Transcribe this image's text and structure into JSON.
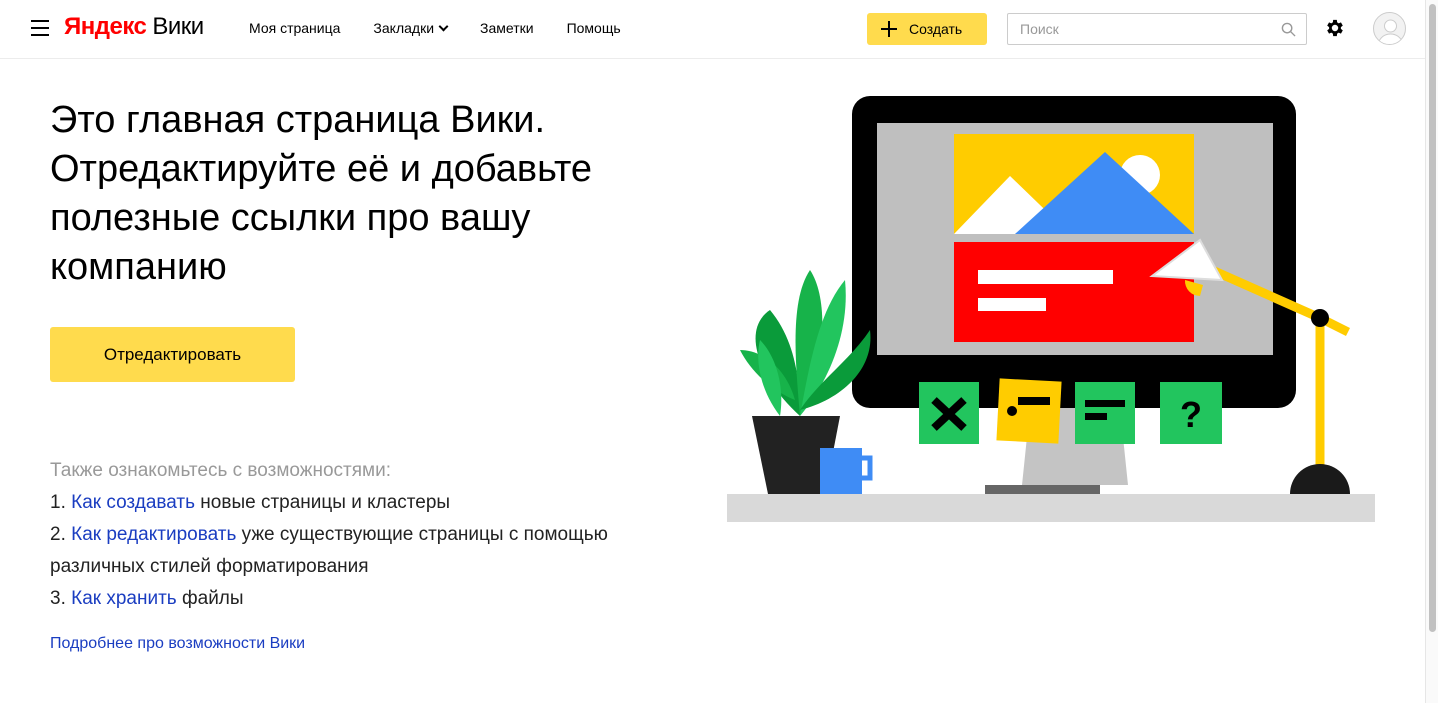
{
  "header": {
    "logo_brand": "Яндекс",
    "logo_product": "Вики",
    "nav": [
      {
        "label": "Моя страница"
      },
      {
        "label": "Закладки"
      },
      {
        "label": "Заметки"
      },
      {
        "label": "Помощь"
      }
    ],
    "create_label": "Создать",
    "search_placeholder": "Поиск",
    "icons": {
      "menu": "hamburger-icon",
      "search": "magnifier-icon",
      "settings": "gear-icon",
      "avatar": "user-avatar"
    }
  },
  "main": {
    "headline": "Это главная страница Вики. Отредактируйте её и добавьте полезные ссылки про вашу компанию",
    "edit_button": "Отредактировать",
    "features_intro": "Также ознакомьтесь с возможностями:",
    "features": [
      {
        "num": "1.",
        "link": "Как создавать",
        "text": " новые страницы и кластеры"
      },
      {
        "num": "2.",
        "link": "Как редактировать",
        "text": " уже существующие страницы с помощью различных стилей форматирования"
      },
      {
        "num": "3.",
        "link": "Как хранить",
        "text": " файлы"
      }
    ],
    "more_link": "Подробнее про возможности Вики"
  },
  "colors": {
    "accent": "#ffdb4d",
    "link": "#1a3dc1",
    "logo_red": "#ff0000"
  }
}
